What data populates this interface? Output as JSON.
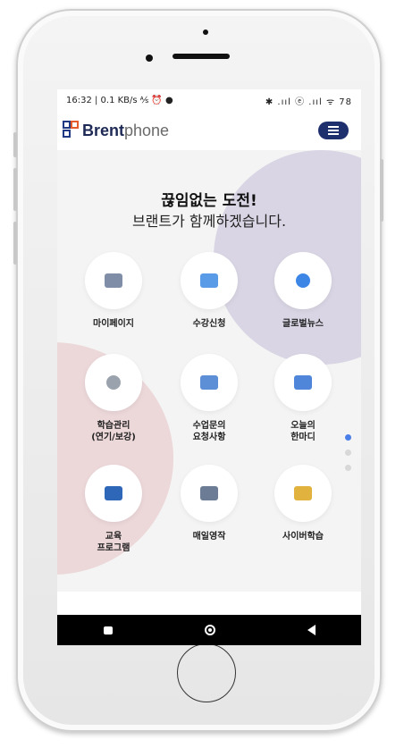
{
  "status": {
    "left": "16:32 | 0.1 KB/s ⅍ ⏰ ●",
    "right": "✱ .ııl ⓔ .ııl ᯤ 78"
  },
  "brand": {
    "strong": "Brent",
    "light": "phone"
  },
  "hero": {
    "title": "끊임없는 도전!",
    "subtitle": "브랜트가 함께하겠습니다."
  },
  "menu": [
    {
      "label": "마이페이지",
      "icon": "user-gear-icon",
      "color": "#7f8ea6"
    },
    {
      "label": "수강신청",
      "icon": "calendar-icon",
      "color": "#5a9be8"
    },
    {
      "label": "글로벌뉴스",
      "icon": "globe-icon",
      "color": "#3d86e6"
    },
    {
      "label": "학습관리\n(연기/보강)",
      "icon": "award-icon",
      "color": "#9aa3ad"
    },
    {
      "label": "수업문의\n요청사항",
      "icon": "edit-note-icon",
      "color": "#5c8fd6"
    },
    {
      "label": "오늘의\n한마디",
      "icon": "chat-icon",
      "color": "#4f86d9"
    },
    {
      "label": "교육\n프로그램",
      "icon": "book-icon",
      "color": "#2f67b8"
    },
    {
      "label": "매일영작",
      "icon": "screen-play-icon",
      "color": "#6b7c94"
    },
    {
      "label": "사이버학습",
      "icon": "monitor-icon",
      "color": "#e2b23e"
    }
  ],
  "colors": {
    "accent": "#1e2f6e",
    "purple_circle": "#d9d5e4",
    "pink_circle": "#ecd7d9",
    "active_dot": "#4a7ee8"
  }
}
